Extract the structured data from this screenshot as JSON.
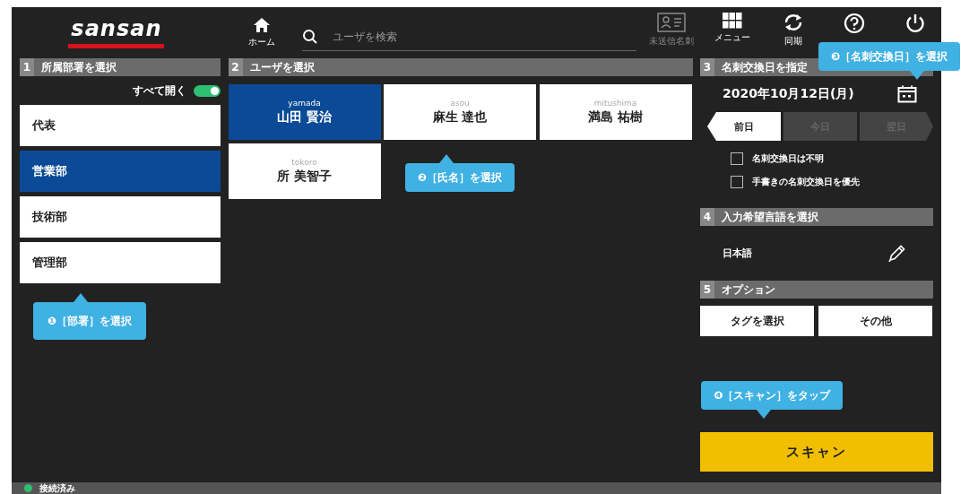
{
  "header": {
    "logo": "sansan",
    "home": {
      "label": "ホーム"
    },
    "search": {
      "placeholder": "ユーザを検索"
    },
    "tools": [
      {
        "kind": "card",
        "label": "未送信名刺",
        "disabled": true
      },
      {
        "kind": "grid",
        "label": "メニュー",
        "disabled": false
      },
      {
        "kind": "sync",
        "label": "同期",
        "disabled": false
      },
      {
        "kind": "help",
        "disabled": false
      },
      {
        "kind": "power",
        "disabled": false
      }
    ]
  },
  "departments": {
    "number": "1",
    "title": "所属部署を選択",
    "expand_all": {
      "label": "すべて開く",
      "on": true
    },
    "items": [
      {
        "label": "代表",
        "selected": false
      },
      {
        "label": "営業部",
        "selected": true
      },
      {
        "label": "技術部",
        "selected": false
      },
      {
        "label": "管理部",
        "selected": false
      }
    ]
  },
  "users": {
    "number": "2",
    "title": "ユーザを選択",
    "items": [
      {
        "romaji": "yamada",
        "name": "山田 賢治",
        "selected": true
      },
      {
        "romaji": "asou",
        "name": "麻生 達也",
        "selected": false
      },
      {
        "romaji": "mitushima",
        "name": "満島 祐樹",
        "selected": false
      },
      {
        "romaji": "tokoro",
        "name": "所 美智子",
        "selected": false
      }
    ]
  },
  "exchange_date": {
    "number": "3",
    "title": "名刺交換日を指定",
    "value": "2020年10月12日(月)",
    "days": [
      {
        "label": "前日",
        "disabled": false
      },
      {
        "label": "今日",
        "disabled": true
      },
      {
        "label": "翌日",
        "disabled": true
      }
    ],
    "options": [
      {
        "label": "名刺交換日は不明",
        "checked": false
      },
      {
        "label": "手書きの名刺交換日を優先",
        "checked": false
      }
    ]
  },
  "language": {
    "number": "4",
    "title": "入力希望言語を選択",
    "value": "日本語"
  },
  "options": {
    "number": "5",
    "title": "オプション",
    "buttons": [
      "タグを選択",
      "その他"
    ]
  },
  "scan_button": "スキャン",
  "status_bar": {
    "label": "接続済み",
    "connected": true
  },
  "callouts": [
    "❶［部署］を選択",
    "❷［氏名］を選択",
    "❸［名刺交換日］を選択",
    "❹［スキャン］をタップ"
  ]
}
